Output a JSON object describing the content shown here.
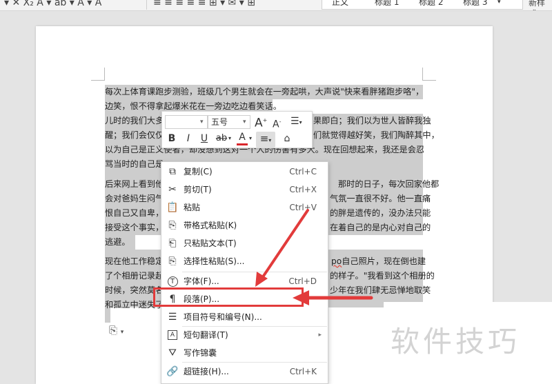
{
  "ribbon": {
    "style_gallery": [
      "正文",
      "标题 1",
      "标题 2",
      "标题 3"
    ],
    "new_style_label": "新样式"
  },
  "document": {
    "lines": [
      "每次上体育课跑步测验，班级几个男生就会在一旁起哄，大声说\"快来看胖猪跑步咯\"，边说",
      "边笑，恨不得拿起爆米花在一旁边吃边看笑话。",
      "儿时的我们大多",
      "醒；我们会仅仅",
      "以为自己是正义使者，却没想到这对一个人的伤害有多大。现在回想起来，我还是会忍不住",
      "骂当时的自己是",
      "后来网上看到他",
      "会对爸妈生闷气",
      "恨自己又自卑，",
      "接受这个事实，",
      "逃避。",
      "现在他工作稳定",
      "了个相册记录起",
      "时候，突然莫名",
      "和孤立中迷失了"
    ],
    "right_fragments": [
      "果即白；我们以为世人皆醉我独",
      "们就觉得越好笑，我们陶醉其中，",
      "那时的日子，每次回家他都",
      "气氛一直很不好。他一直痛",
      "的胖是遗传的，没办法只能",
      "在着自己的是内心对自己的",
      "自己照片，现在倒也建",
      "的样子。\"我看到这个相册的",
      "少年在我们肆无忌惮地取笑"
    ],
    "underlined_word": "po"
  },
  "mini_toolbar": {
    "font_name": "",
    "font_size": "五号",
    "grow_font": "A",
    "shrink_font": "A",
    "bold": "B",
    "italic": "I",
    "underline": "U",
    "strike": "ab",
    "font_color": "A",
    "align": "≡",
    "format_painter": "⌂"
  },
  "context_menu": {
    "items": [
      {
        "label": "复制(C)",
        "shortcut": "Ctrl+C",
        "icon": "copy-icon"
      },
      {
        "label": "剪切(T)",
        "shortcut": "Ctrl+X",
        "icon": "scissors-icon"
      },
      {
        "label": "粘贴",
        "shortcut": "Ctrl+V",
        "icon": "paste-icon"
      },
      {
        "label": "带格式粘贴(K)",
        "shortcut": "",
        "icon": "paste-format-icon"
      },
      {
        "label": "只粘贴文本(T)",
        "shortcut": "",
        "icon": "paste-text-icon"
      },
      {
        "label": "选择性粘贴(S)...",
        "shortcut": "",
        "icon": "paste-special-icon"
      },
      {
        "label": "字体(F)...",
        "shortcut": "Ctrl+D",
        "icon": "font-icon"
      },
      {
        "label": "段落(P)...",
        "shortcut": "",
        "icon": "paragraph-icon"
      },
      {
        "label": "项目符号和编号(N)...",
        "shortcut": "",
        "icon": "bullets-icon"
      },
      {
        "label": "短句翻译(T)",
        "shortcut": "",
        "icon": "translate-icon"
      },
      {
        "label": "写作锦囊",
        "shortcut": "",
        "icon": "writing-icon"
      },
      {
        "label": "超链接(H)...",
        "shortcut": "Ctrl+K",
        "icon": "link-icon"
      }
    ]
  },
  "watermark": "软件技巧",
  "colors": {
    "highlight_red": "#e23b3b",
    "selection_gray": "#cdcdcd"
  }
}
